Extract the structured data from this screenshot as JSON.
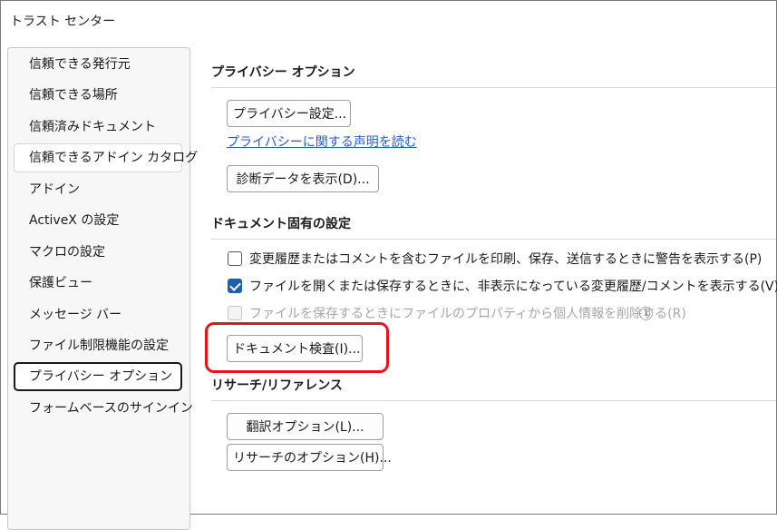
{
  "window": {
    "title": "トラスト センター"
  },
  "sidebar": {
    "items": [
      {
        "label": "信頼できる発行元"
      },
      {
        "label": "信頼できる場所"
      },
      {
        "label": "信頼済みドキュメント"
      },
      {
        "label": "信頼できるアドイン カタログ"
      },
      {
        "label": "アドイン"
      },
      {
        "label": "ActiveX の設定"
      },
      {
        "label": "マクロの設定"
      },
      {
        "label": "保護ビュー"
      },
      {
        "label": "メッセージ バー"
      },
      {
        "label": "ファイル制限機能の設定"
      },
      {
        "label": "プライバシー オプション"
      },
      {
        "label": "フォームベースのサインイン"
      }
    ],
    "highlighted_index": 3,
    "selected_index": 10
  },
  "privacy_options": {
    "header": "プライバシー オプション",
    "privacy_settings_button": "プライバシー設定...",
    "privacy_statement_link": "プライバシーに関する声明を読む",
    "diagnostic_data_button": "診断データを表示(D)..."
  },
  "document_specific": {
    "header": "ドキュメント固有の設定",
    "checkboxes": [
      {
        "label": "変更履歴またはコメントを含むファイルを印刷、保存、送信するときに警告を表示する(P)",
        "checked": false,
        "enabled": true
      },
      {
        "label": "ファイルを開くまたは保存するときに、非表示になっている変更履歴/コメントを表示する(V)",
        "checked": true,
        "enabled": true
      },
      {
        "label": "ファイルを保存するときにファイルのプロパティから個人情報を削除する(R)",
        "checked": false,
        "enabled": false
      }
    ],
    "info_icon": "info-icon",
    "document_inspector_button": "ドキュメント検査(I)..."
  },
  "research_reference": {
    "header": "リサーチ/リファレンス",
    "translation_options_button": "翻訳オプション(L)...",
    "research_options_button": "リサーチのオプション(H)..."
  },
  "colors": {
    "link": "#1f5fc7",
    "checkbox_checked": "#1a5fb4",
    "annotation": "#e8141b"
  }
}
